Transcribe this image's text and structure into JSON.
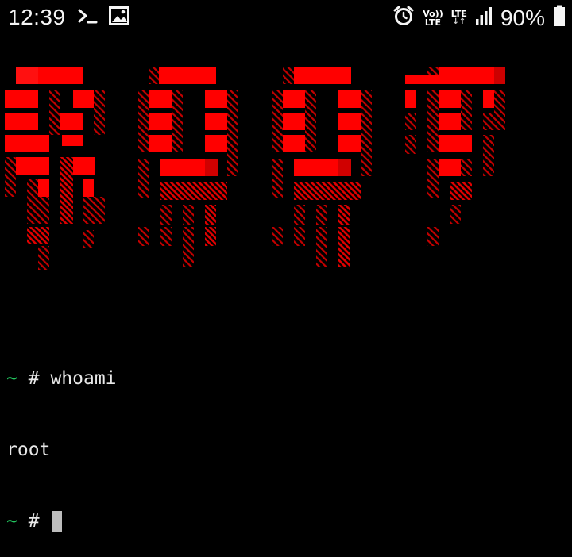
{
  "status_bar": {
    "time": "12:39",
    "network_top": "Vo))",
    "network_bottom": "LTE",
    "lte_top": "LTE",
    "lte_arrows": "↓↑",
    "battery_percent": "90%",
    "icons": [
      "terminal-icon",
      "image-icon",
      "alarm-icon",
      "signal-icon",
      "battery-icon"
    ],
    "signal_level": 0.75,
    "battery_level": 0.9
  },
  "banner": {
    "text": "ROOT",
    "color_primary": "#ff0000",
    "color_shadow": "#b30000"
  },
  "terminal": {
    "lines": [
      {
        "prompt_symbol": "~",
        "prompt_char": "#",
        "command": "whoami"
      },
      {
        "output": "root"
      },
      {
        "prompt_symbol": "~",
        "prompt_char": "#",
        "command": ""
      }
    ],
    "prompt_color": "#22c55e"
  }
}
